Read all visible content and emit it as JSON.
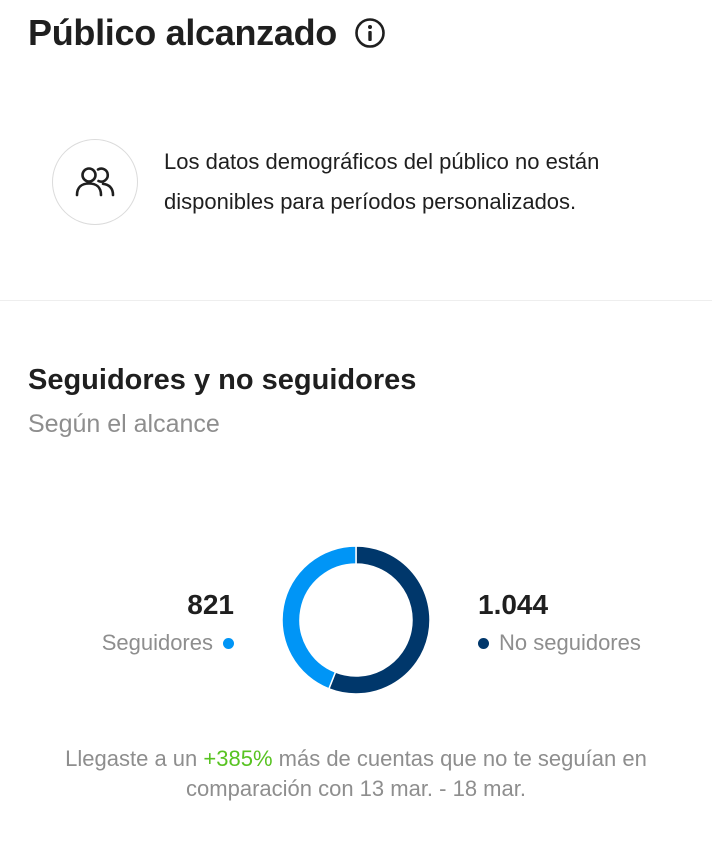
{
  "audience": {
    "title": "Público alcanzado",
    "info_icon": "info-circle-icon",
    "notice_icon": "people-icon",
    "notice_text": "Los datos demográficos del público no están disponibles para períodos personalizados."
  },
  "followers_section": {
    "title": "Seguidores y no seguidores",
    "subtitle": "Según el alcance",
    "followers": {
      "value": "821",
      "label": "Seguidores",
      "color": "#0095f6"
    },
    "non_followers": {
      "value": "1.044",
      "label": "No seguidores",
      "color": "#00376b"
    },
    "footer": {
      "prefix": "Llegaste a un ",
      "highlight": "+385%",
      "highlight_color": "#58c322",
      "suffix": " más de cuentas que no te seguían en comparación con 13 mar. - 18 mar."
    }
  },
  "chart_data": {
    "type": "pie",
    "categories": [
      "Seguidores",
      "No seguidores"
    ],
    "values": [
      821,
      1044
    ],
    "colors": [
      "#0095f6",
      "#00376b"
    ]
  }
}
